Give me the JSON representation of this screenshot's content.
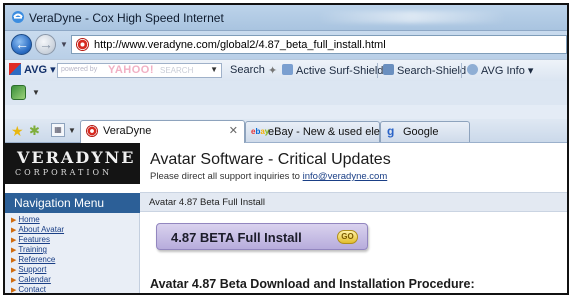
{
  "window": {
    "title": "VeraDyne - Cox High Speed Internet"
  },
  "address_bar": {
    "url": "http://www.veradyne.com/global2/4.87_beta_full_install.html"
  },
  "toolbar": {
    "avg_label": "AVG",
    "yahoo_powered": "powered by",
    "yahoo_logo": "YAHOO!",
    "yahoo_search": "SEARCH",
    "search_label": "Search",
    "active_surf_shield": "Active Surf-Shield",
    "search_shield": "Search-Shield",
    "avg_info": "AVG Info"
  },
  "tabs": [
    {
      "label": "VeraDyne",
      "active": true
    },
    {
      "label": "eBay - New & used electro...",
      "active": false
    },
    {
      "label": "Google",
      "active": false
    }
  ],
  "brand": {
    "name": "VeraDyne",
    "subtitle": "Corporation"
  },
  "nav": {
    "heading": "Navigation Menu",
    "items": [
      "Home",
      "About Avatar",
      "Features",
      "Training",
      "Reference",
      "Support",
      "Calendar",
      "Contact"
    ]
  },
  "content": {
    "heading": "Avatar Software - Critical Updates",
    "support_prefix": "Please direct all support inquiries to",
    "support_email": "info@veradyne.com",
    "crumb": "Avatar 4.87 Beta Full Install",
    "install_button": "4.87 BETA Full Install",
    "go_label": "GO",
    "section_heading": "Avatar 4.87 Beta Download and Installation Procedure:"
  },
  "colors": {
    "nav_heading_bg": "#2c5f97",
    "brand_bg": "#141414",
    "button_bg": "#c6bde6"
  }
}
